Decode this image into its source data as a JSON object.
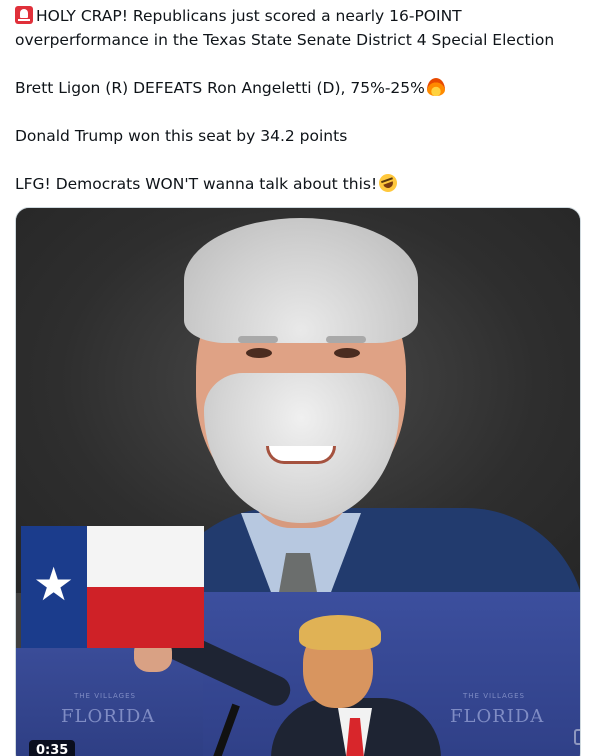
{
  "tweet": {
    "lines": [
      {
        "emoji": "rotating-light-emoji",
        "text": "HOLY CRAP! Republicans just scored a nearly 16-POINT"
      },
      {
        "text": "overperformance in the Texas State Senate District 4 Special Election"
      },
      {
        "text": "Brett Ligon (R) DEFEATS Ron Angeletti (D), 75%-25%",
        "trailing_emoji": "fire-emoji"
      },
      {
        "text": "Donald Trump won this seat by 34.2 points"
      },
      {
        "text": "LFG! Democrats WON'T wanna talk about this!",
        "trailing_emoji": "rolling-laughing-emoji"
      }
    ]
  },
  "media": {
    "video_duration": "0:35",
    "banner_left": {
      "small": "THE VILLAGES",
      "large": "FLORIDA"
    },
    "banner_right": {
      "small": "THE VILLAGES",
      "large": "FLORIDA"
    },
    "colors": {
      "flag_blue": "#1b3c8c",
      "flag_red": "#cf2127",
      "stage_blue": "#34459a",
      "suit_navy": "#223b6e"
    }
  }
}
